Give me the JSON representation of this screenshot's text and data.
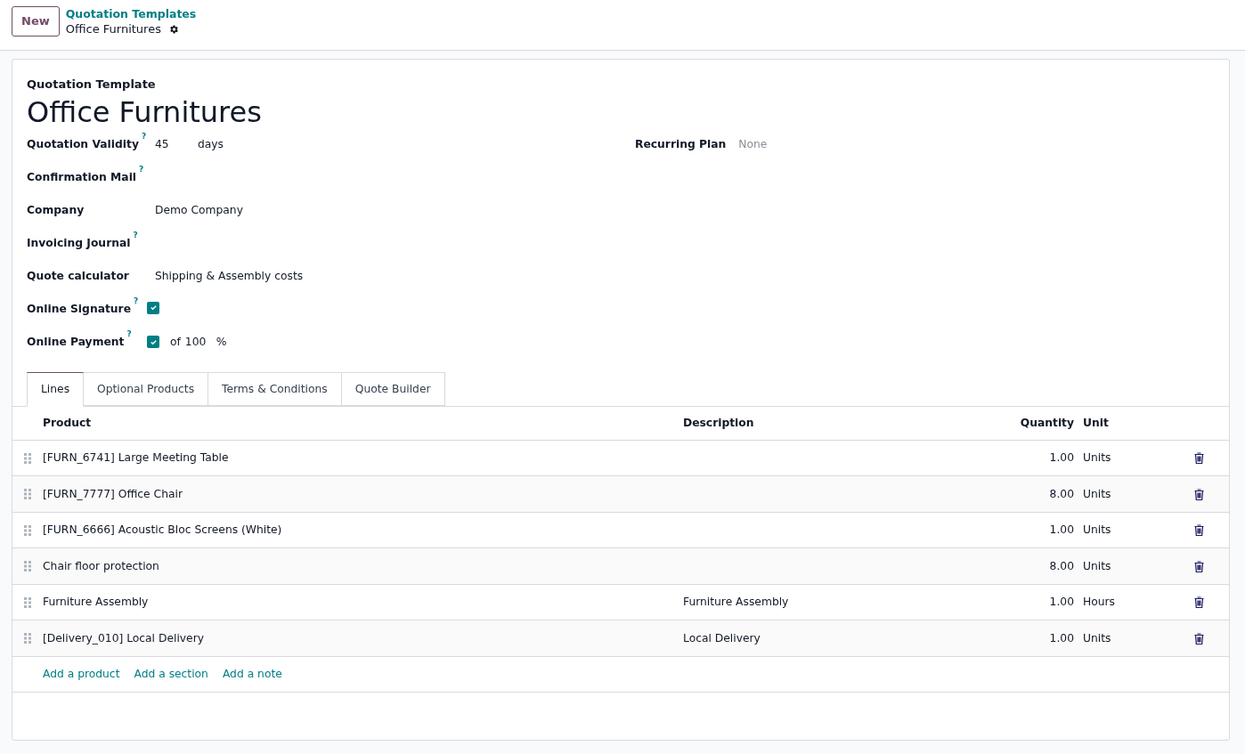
{
  "control_panel": {
    "new_button": "New",
    "breadcrumb": "Quotation Templates",
    "record_name": "Office Furnitures"
  },
  "form": {
    "title_label": "Quotation Template",
    "title": "Office Furnitures",
    "fields": [
      {
        "kind": "number_unit",
        "label": "Quotation Validity",
        "help": "?",
        "value": "45",
        "suffix": "days"
      },
      {
        "kind": "text",
        "label": "Confirmation Mail",
        "help": "?"
      },
      {
        "kind": "text",
        "label": "Company",
        "value": "Demo Company"
      },
      {
        "kind": "text",
        "label": "Invoicing Journal",
        "help": "?"
      },
      {
        "kind": "text",
        "label": "Quote calculator",
        "value": "Shipping & Assembly costs"
      },
      {
        "kind": "checkbox",
        "label": "Online Signature",
        "help": "?",
        "checked": true
      },
      {
        "kind": "checkbox_percent",
        "label": "Online Payment",
        "help": "?",
        "checked": true,
        "prefix": "of",
        "value": "100",
        "suffix": "%"
      }
    ],
    "right_fields": [
      {
        "label": "Recurring Plan",
        "placeholder": "None"
      }
    ],
    "tabs": [
      {
        "label": "Lines",
        "selected": true
      },
      {
        "label": "Optional Products",
        "selected": false
      },
      {
        "label": "Terms & Conditions",
        "selected": false
      },
      {
        "label": "Quote Builder",
        "selected": false
      }
    ],
    "table": {
      "columns": [
        "Product",
        "Description",
        "Quantity",
        "Unit"
      ],
      "rows": [
        {
          "product": "[FURN_6741] Large Meeting Table",
          "quantity": "1.00",
          "unit": "Units"
        },
        {
          "product": "[FURN_7777] Office Chair",
          "quantity": "8.00",
          "unit": "Units"
        },
        {
          "product": "[FURN_6666] Acoustic Bloc Screens (White)",
          "quantity": "1.00",
          "unit": "Units"
        },
        {
          "product": "Chair floor protection",
          "quantity": "8.00",
          "unit": "Units"
        },
        {
          "product": "Furniture Assembly",
          "description": "Furniture Assembly",
          "quantity": "1.00",
          "unit": "Hours"
        },
        {
          "product": "[Delivery_010] Local Delivery",
          "description": "Local Delivery",
          "quantity": "1.00",
          "unit": "Units"
        }
      ],
      "add_links": [
        "Add a product",
        "Add a section",
        "Add a note"
      ]
    }
  }
}
